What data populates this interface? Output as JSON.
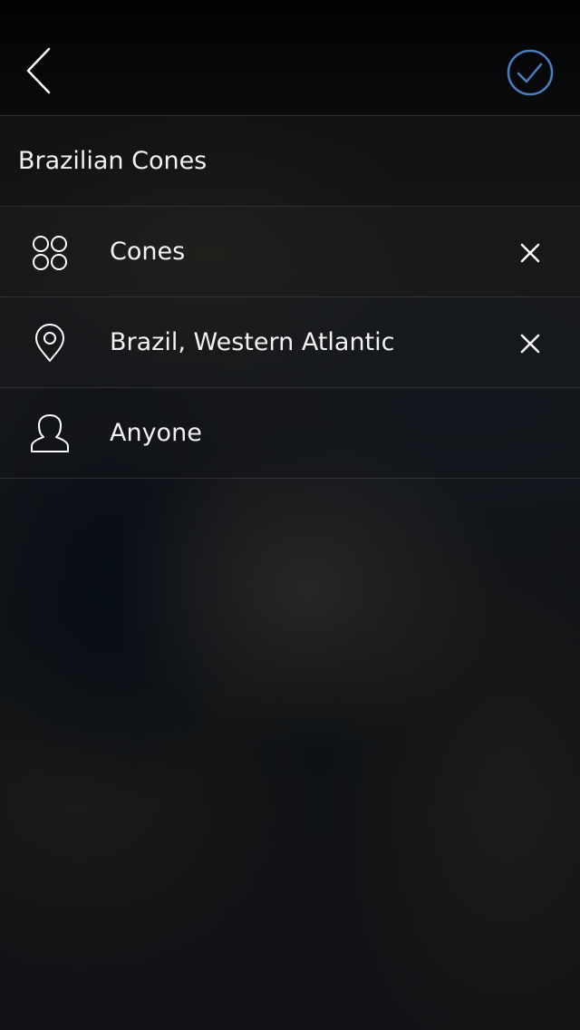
{
  "header": {
    "back_icon": "chevron-left-icon",
    "confirm_icon": "checkmark-circle-icon",
    "accent_color": "#4a7fc1"
  },
  "title": "Brazilian Cones",
  "filters": [
    {
      "icon": "four-circles-icon",
      "label": "Cones",
      "removable": true
    },
    {
      "icon": "location-pin-icon",
      "label": "Brazil, Western Atlantic",
      "removable": true
    },
    {
      "icon": "person-icon",
      "label": "Anyone",
      "removable": false
    }
  ]
}
